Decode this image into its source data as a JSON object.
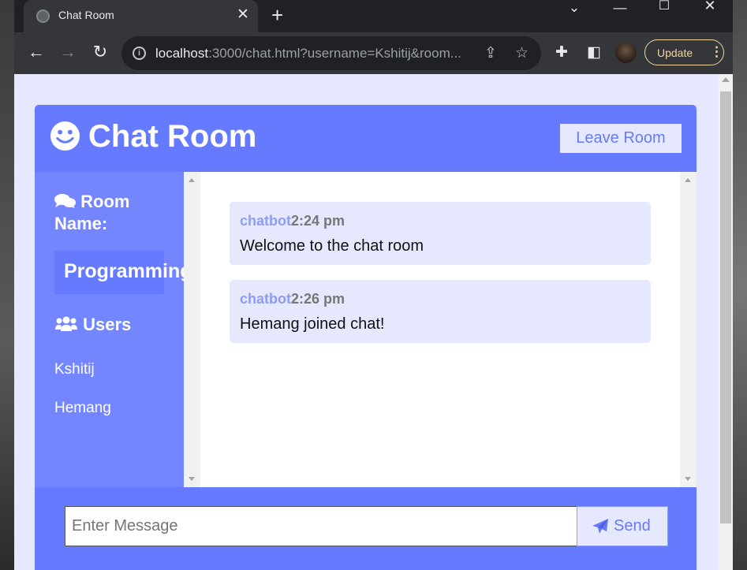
{
  "browser": {
    "tab_title": "Chat Room",
    "url_host": "localhost",
    "url_rest": ":3000/chat.html?username=Kshitij&room...",
    "update_label": "Update"
  },
  "app": {
    "title": "Chat Room",
    "leave_label": "Leave Room"
  },
  "sidebar": {
    "room_heading": "Room Name:",
    "room_name": "Programming",
    "users_heading": "Users",
    "users": [
      "Kshitij",
      "Hemang"
    ]
  },
  "messages": [
    {
      "username": "chatbot",
      "time": "2:24 pm",
      "text": "Welcome to the chat room"
    },
    {
      "username": "chatbot",
      "time": "2:26 pm",
      "text": "Hemang joined chat!"
    }
  ],
  "form": {
    "placeholder": "Enter Message",
    "send_label": "Send"
  },
  "colors": {
    "primary": "#667aff",
    "sidebar": "#7386ff",
    "light": "#e6e8fd"
  }
}
